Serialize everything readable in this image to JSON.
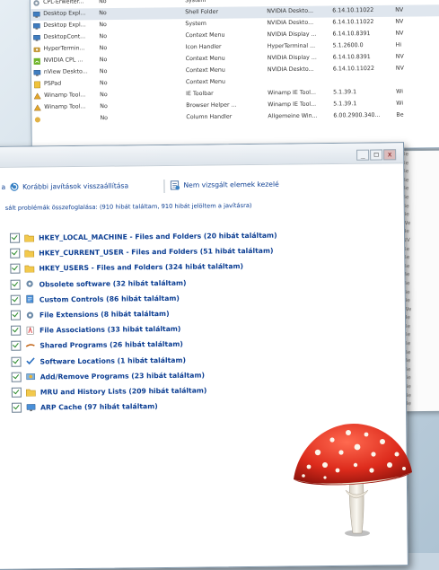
{
  "shell_extensions": {
    "rows": [
      {
        "name": "CPL-Erweiter...",
        "disabled": "No",
        "type": "System",
        "description": "",
        "version": "",
        "company": "",
        "icon": "gear",
        "selected": false
      },
      {
        "name": "Desktop Expl...",
        "disabled": "No",
        "type": "Shell Folder",
        "description": "NVIDIA Deskto...",
        "version": "6.14.10.11022",
        "company": "NV",
        "icon": "monitor",
        "selected": true
      },
      {
        "name": "Desktop Expl...",
        "disabled": "No",
        "type": "System",
        "description": "NVIDIA Deskto...",
        "version": "6.14.10.11022",
        "company": "NV",
        "icon": "monitor",
        "selected": false
      },
      {
        "name": "DesktopCont...",
        "disabled": "No",
        "type": "Context Menu",
        "description": "NVIDIA Display ...",
        "version": "6.14.10.8391",
        "company": "NV",
        "icon": "monitor",
        "selected": false
      },
      {
        "name": "HyperTermin...",
        "disabled": "No",
        "type": "Icon Handler",
        "description": "HyperTerminal ...",
        "version": "5.1.2600.0",
        "company": "Hi",
        "icon": "phone",
        "selected": false
      },
      {
        "name": "NVIDIA CPL ...",
        "disabled": "No",
        "type": "Context Menu",
        "description": "NVIDIA Display ...",
        "version": "6.14.10.8391",
        "company": "NV",
        "icon": "nvidia",
        "selected": false
      },
      {
        "name": "nView Deskto...",
        "disabled": "No",
        "type": "Context Menu",
        "description": "NVIDIA Deskto...",
        "version": "6.14.10.11022",
        "company": "NV",
        "icon": "monitor",
        "selected": false
      },
      {
        "name": "PSPad",
        "disabled": "No",
        "type": "Context Menu",
        "description": "",
        "version": "",
        "company": "",
        "icon": "pad",
        "selected": false
      },
      {
        "name": "Winamp Tool...",
        "disabled": "No",
        "type": "IE Toolbar",
        "description": "Winamp IE Tool...",
        "version": "5.1.39.1",
        "company": "Wi",
        "icon": "winamp",
        "selected": false
      },
      {
        "name": "Winamp Tool...",
        "disabled": "No",
        "type": "Browser Helper ...",
        "description": "Winamp IE Tool...",
        "version": "5.1.39.1",
        "company": "Wi",
        "icon": "winamp",
        "selected": false
      },
      {
        "name": "",
        "disabled": "No",
        "type": "Column Handler",
        "description": "Allgemeine Win...",
        "version": "6.00.2900.340...",
        "company": "Be",
        "icon": "blank",
        "selected": false
      }
    ],
    "right_column": [
      "Be",
      "Be",
      "Be",
      "Be",
      "Be",
      "Be",
      "Be",
      "Be",
      "We",
      "Be",
      "NV",
      "Be",
      "Be",
      "Be",
      "Be",
      "Be",
      "Be",
      "Be",
      "We",
      "Be",
      "Be",
      "Be",
      "Be",
      "Be",
      "Be",
      "Be",
      "Be",
      "Be",
      "Be",
      "Be"
    ]
  },
  "main_window": {
    "controls": {
      "minimize": "_",
      "maximize": "□",
      "close": "x"
    },
    "toolbar": {
      "restore_label": "Korábbi javítások visszaállítása",
      "ignore_label": "Nem vizsgált elemek kezelé"
    },
    "summary": "sált problémák összefoglalása: (910 hibát találtam, 910 hibát jelöltem a javításra)",
    "categories": [
      {
        "label": "HKEY_LOCAL_MACHINE - Files and Folders (20 hibát találtam)",
        "icon": "folder-icon"
      },
      {
        "label": "HKEY_CURRENT_USER - Files and Folders (51 hibát találtam)",
        "icon": "folder-icon"
      },
      {
        "label": "HKEY_USERS - Files and Folders (324 hibát találtam)",
        "icon": "folder-icon"
      },
      {
        "label": "Obsolete software (32 hibát találtam)",
        "icon": "gear-icon"
      },
      {
        "label": "Custom Controls (86 hibát találtam)",
        "icon": "document-icon"
      },
      {
        "label": "File Extensions (8 hibát találtam)",
        "icon": "gear-icon"
      },
      {
        "label": "File Associations (33 hibát találtam)",
        "icon": "file-association-icon"
      },
      {
        "label": "Shared Programs (26 hibát találtam)",
        "icon": "link-icon"
      },
      {
        "label": "Software Locations (1 hibát találtam)",
        "icon": "checkmark-icon"
      },
      {
        "label": "Add/Remove Programs (23 hibát találtam)",
        "icon": "install-icon"
      },
      {
        "label": "MRU and History Lists (209 hibát találtam)",
        "icon": "folder-icon"
      },
      {
        "label": "ARP Cache (97 hibát találtam)",
        "icon": "monitor-icon"
      }
    ]
  }
}
